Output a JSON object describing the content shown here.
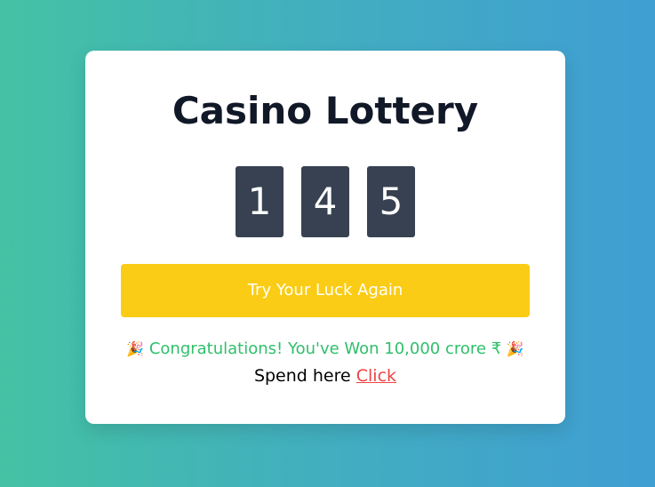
{
  "card": {
    "title": "Casino Lottery",
    "reels": [
      "1",
      "4",
      "5"
    ],
    "button_label": "Try Your Luck Again",
    "result": {
      "emoji_left": "🎉",
      "message": "Congratulations! You've Won 10,000 crore ₹",
      "emoji_right": "🎉"
    },
    "spend": {
      "prefix": "Spend here",
      "link_label": "Click"
    }
  },
  "colors": {
    "background_start": "#44c2a4",
    "background_end": "#3f9ed3",
    "reel_bg": "#374151",
    "button_bg": "#facc15",
    "success_text": "#2fbf6a",
    "link": "#ef4444"
  }
}
